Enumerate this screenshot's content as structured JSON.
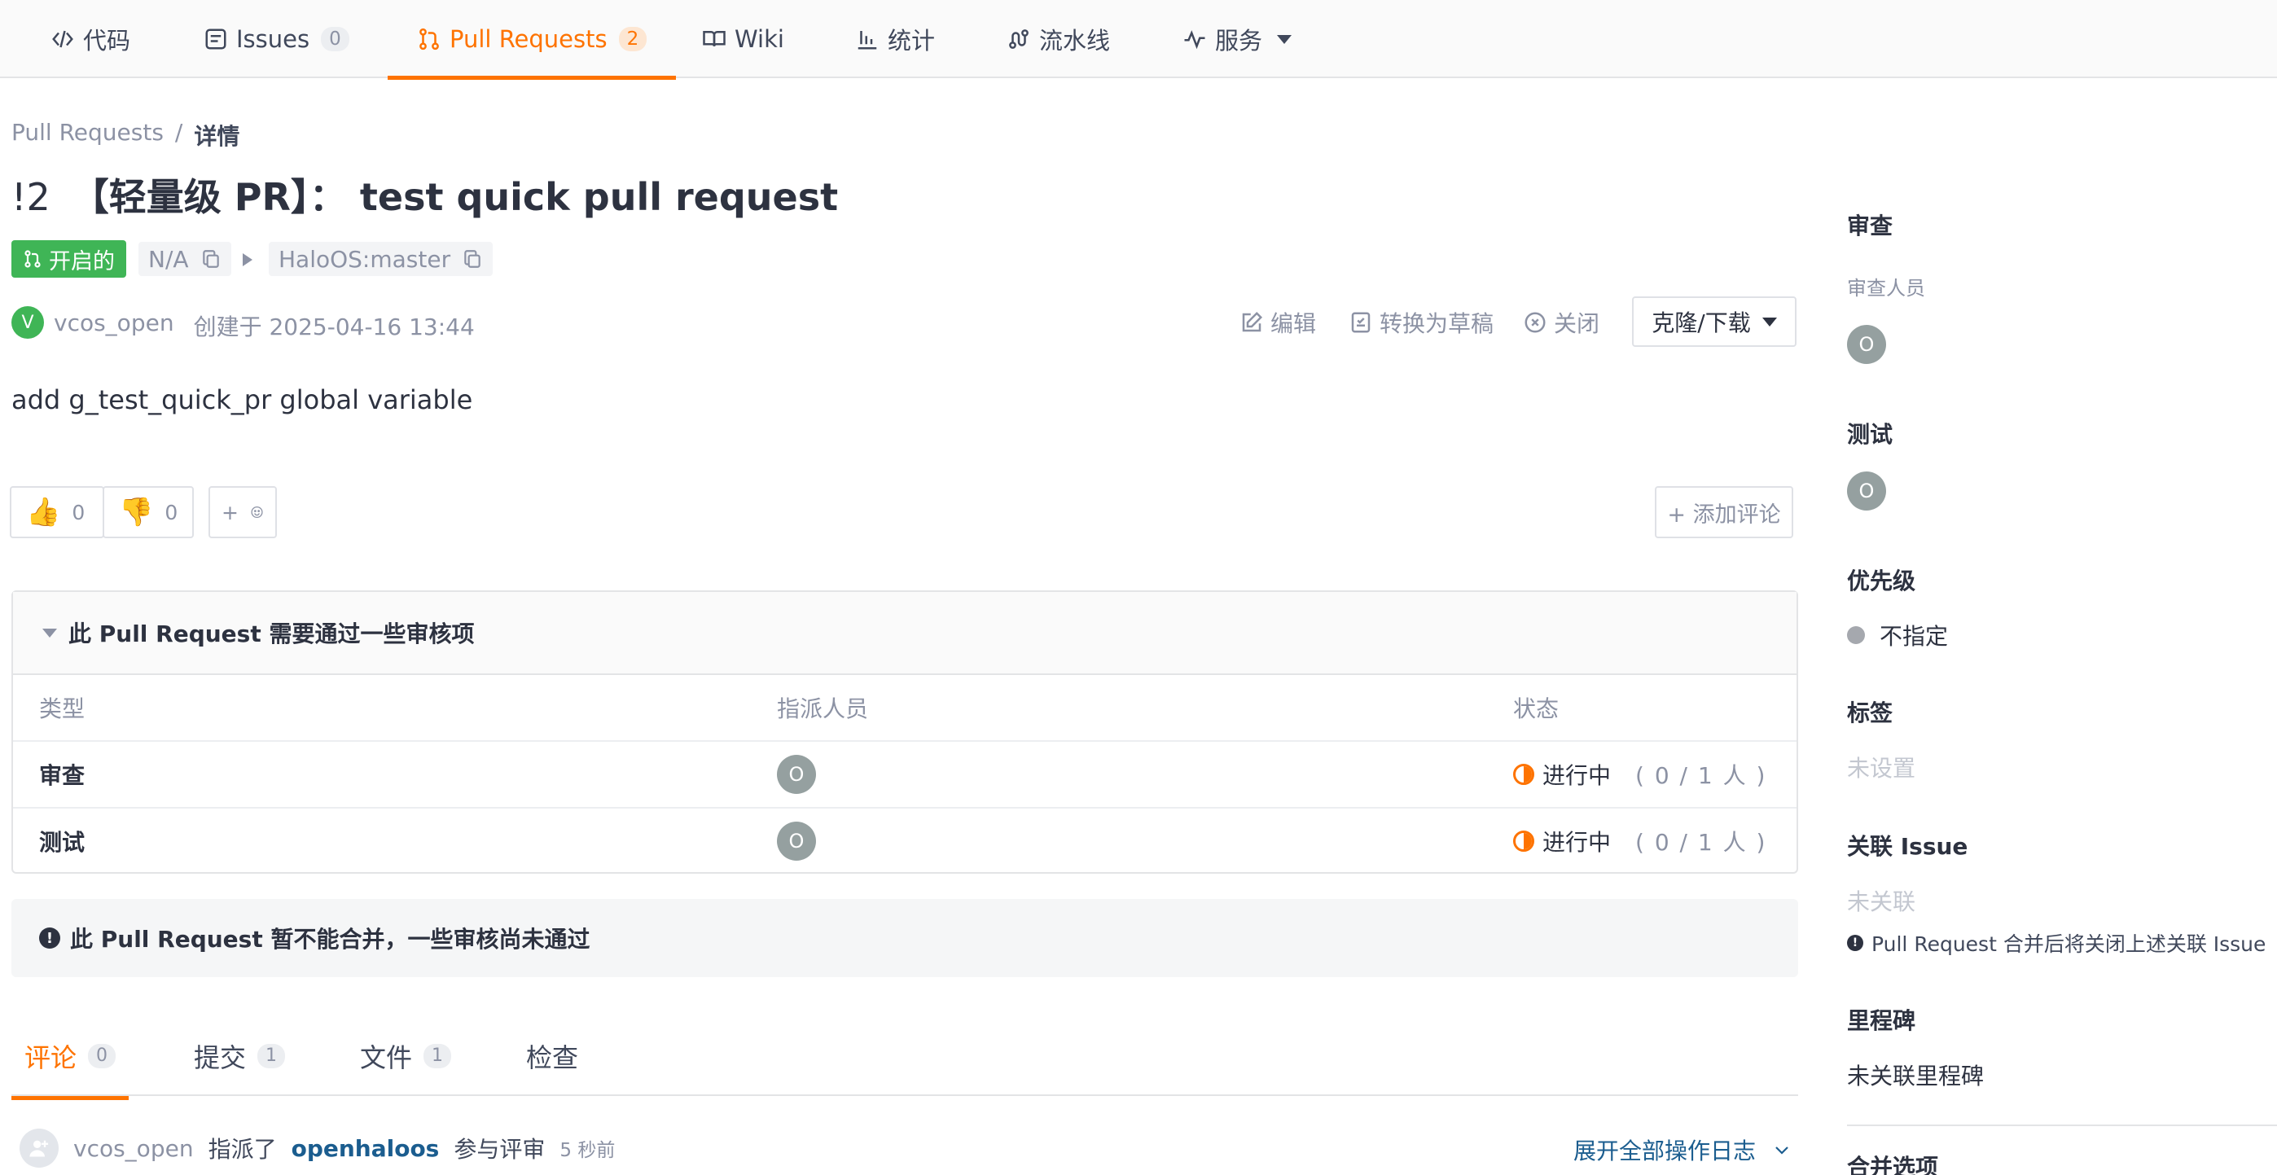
{
  "nav": {
    "tabs": [
      {
        "label": "代码",
        "icon": "code-icon"
      },
      {
        "label": "Issues",
        "count": "0",
        "icon": "issues-icon"
      },
      {
        "label": "Pull Requests",
        "count": "2",
        "icon": "pull-request-icon",
        "active": true
      },
      {
        "label": "Wiki",
        "icon": "book-icon"
      },
      {
        "label": "统计",
        "icon": "bar-chart-icon"
      },
      {
        "label": "流水线",
        "icon": "pipeline-icon"
      },
      {
        "label": "服务",
        "icon": "activity-icon"
      }
    ]
  },
  "breadcrumb": {
    "root": "Pull Requests",
    "sep": "/",
    "current": "详情"
  },
  "pr": {
    "number": "!2",
    "title": "【轻量级 PR】： test quick pull request",
    "status": "开启的",
    "source_branch": "N/A",
    "target_branch": "HaloOS:master",
    "author_initial": "V",
    "author": "vcos_open",
    "created": "创建于 2025-04-16 13:44",
    "description": "add g_test_quick_pr global variable"
  },
  "actions": {
    "edit": "编辑",
    "to_draft": "转换为草稿",
    "close": "关闭",
    "clone": "克隆/下载"
  },
  "reactions": {
    "thumbs_up": "0",
    "thumbs_down": "0",
    "add": "+",
    "add_comment": "+ 添加评论"
  },
  "checks": {
    "title": "此 Pull Request 需要通过一些审核项",
    "headers": [
      "类型",
      "指派人员",
      "状态"
    ],
    "rows": [
      {
        "type": "审查",
        "assignee": "O",
        "status": "进行中",
        "count": "( 0 / 1 人 )"
      },
      {
        "type": "测试",
        "assignee": "O",
        "status": "进行中",
        "count": "( 0 / 1 人 )"
      }
    ]
  },
  "merge_warning": "此 Pull Request 暂不能合并，一些审核尚未通过",
  "bottom_tabs": [
    {
      "label": "评论",
      "count": "0",
      "active": true
    },
    {
      "label": "提交",
      "count": "1"
    },
    {
      "label": "文件",
      "count": "1"
    },
    {
      "label": "检查"
    }
  ],
  "activity": {
    "user": "vcos_open",
    "verb": "指派了",
    "target": "openhaloos",
    "suffix": "参与评审",
    "time": "5 秒前",
    "expand": "展开全部操作日志"
  },
  "sidebar": {
    "review": {
      "title": "审查",
      "sub": "审查人员",
      "avatar": "O"
    },
    "test": {
      "title": "测试",
      "avatar": "O"
    },
    "priority": {
      "title": "优先级",
      "value": "不指定"
    },
    "labels": {
      "title": "标签",
      "value": "未设置"
    },
    "issue": {
      "title": "关联 Issue",
      "value": "未关联",
      "note": "Pull Request 合并后将关闭上述关联 Issue"
    },
    "milestone": {
      "title": "里程碑",
      "value": "未关联里程碑"
    },
    "merge": {
      "title": "合并选项"
    }
  },
  "colors": {
    "accent": "#fe7300",
    "open_green": "#3fb556",
    "link": "#1b5d8f"
  }
}
